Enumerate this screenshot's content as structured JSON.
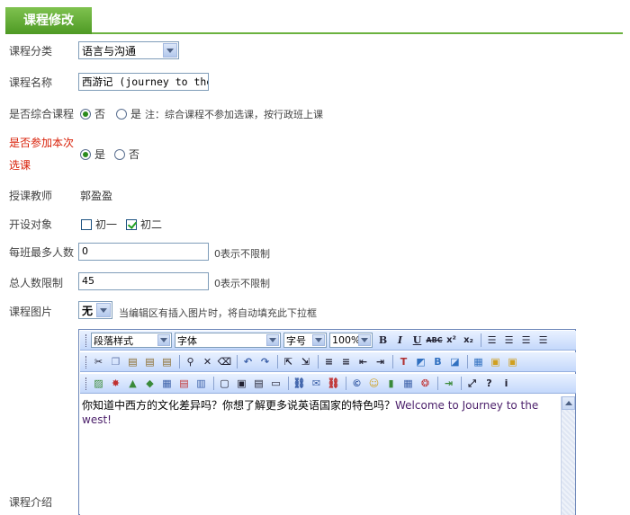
{
  "header": {
    "title": "课程修改"
  },
  "fields": {
    "category": {
      "label": "课程分类",
      "value": "语言与沟通"
    },
    "name": {
      "label": "课程名称",
      "value": "西游记 (journey to the"
    },
    "comprehensive": {
      "label": "是否综合课程",
      "opt_no": "否",
      "opt_yes": "是",
      "note": "注：综合课程不参加选课，按行政班上课"
    },
    "participate": {
      "label_line1": "是否参加本次",
      "label_line2": "选课",
      "opt_yes": "是",
      "opt_no": "否"
    },
    "teacher": {
      "label": "授课教师",
      "value": "郭盈盈"
    },
    "target": {
      "label": "开设对象",
      "opt_grade1": "初一",
      "opt_grade2": "初二"
    },
    "max_per_class": {
      "label": "每班最多人数",
      "value": "0",
      "hint": "0表示不限制"
    },
    "total_limit": {
      "label": "总人数限制",
      "value": "45",
      "hint": "0表示不限制"
    },
    "image": {
      "label": "课程图片",
      "value": "无",
      "hint": "当编辑区有插入图片时，将自动填充此下拉框"
    },
    "intro": {
      "label": "课程介绍"
    }
  },
  "editor": {
    "paragraph_style": "段落样式",
    "font": "字体",
    "font_size": "字号",
    "zoom": "100%",
    "content_cn": "你知道中西方的文化差异吗？你想了解更多说英语国家的特色吗？",
    "content_en": "Welcome to Journey to the west!"
  }
}
